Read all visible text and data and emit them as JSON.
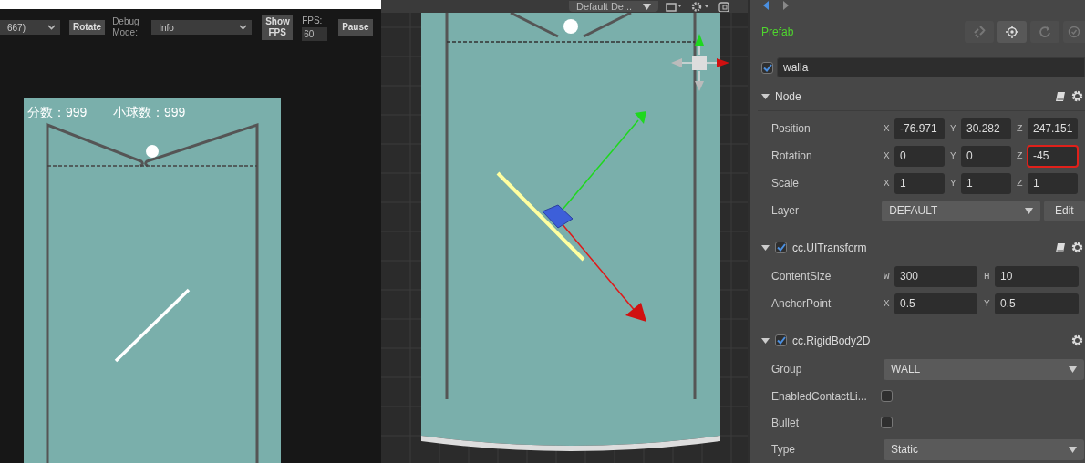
{
  "preview_toolbar": {
    "resolution_select": "667)",
    "rotate_button": "Rotate",
    "debug_mode_label": "Debug Mode:",
    "debug_mode_select": "Info",
    "show_fps_button": "Show FPS",
    "fps_label": "FPS:",
    "fps_value": "60",
    "pause_button": "Pause"
  },
  "game": {
    "score_label": "分数：999",
    "balls_label": "小球数：999"
  },
  "scene_toolbar": {
    "camera_select": "Default De..."
  },
  "inspector": {
    "title": "Prefab",
    "node_enabled": true,
    "node_name": "walla",
    "components": [
      {
        "title": "Node",
        "help": true,
        "rows": [
          {
            "kind": "vector",
            "label": "Position",
            "fields": [
              {
                "axis": "X",
                "value": "-76.971",
                "highlighted": false
              },
              {
                "axis": "Y",
                "value": "30.282",
                "highlighted": false
              },
              {
                "axis": "Z",
                "value": "247.151",
                "highlighted": false
              }
            ]
          },
          {
            "kind": "vector",
            "label": "Rotation",
            "fields": [
              {
                "axis": "X",
                "value": "0",
                "highlighted": false
              },
              {
                "axis": "Y",
                "value": "0",
                "highlighted": false
              },
              {
                "axis": "Z",
                "value": "-45",
                "highlighted": true
              }
            ]
          },
          {
            "kind": "vector",
            "label": "Scale",
            "fields": [
              {
                "axis": "X",
                "value": "1",
                "highlighted": false
              },
              {
                "axis": "Y",
                "value": "1",
                "highlighted": false
              },
              {
                "axis": "Z",
                "value": "1",
                "highlighted": false
              }
            ]
          },
          {
            "kind": "select",
            "label": "Layer",
            "value": "DEFAULT",
            "button": "Edit"
          }
        ]
      },
      {
        "title": "cc.UITransform",
        "enabled": true,
        "help": true,
        "rows": [
          {
            "kind": "vector",
            "label": "ContentSize",
            "fields": [
              {
                "axis": "W",
                "value": "300",
                "highlighted": false
              },
              {
                "axis": "H",
                "value": "10",
                "highlighted": false
              }
            ]
          },
          {
            "kind": "vector",
            "label": "AnchorPoint",
            "fields": [
              {
                "axis": "X",
                "value": "0.5",
                "highlighted": false
              },
              {
                "axis": "Y",
                "value": "0.5",
                "highlighted": false
              }
            ]
          }
        ]
      },
      {
        "title": "cc.RigidBody2D",
        "enabled": true,
        "help": false,
        "rows": [
          {
            "kind": "select",
            "label": "Group",
            "value": "WALL"
          },
          {
            "kind": "checkbox",
            "label": "EnabledContactLi...",
            "checked": false
          },
          {
            "kind": "checkbox",
            "label": "Bullet",
            "checked": false
          },
          {
            "kind": "select",
            "label": "Type",
            "value": "Static"
          }
        ]
      }
    ]
  }
}
